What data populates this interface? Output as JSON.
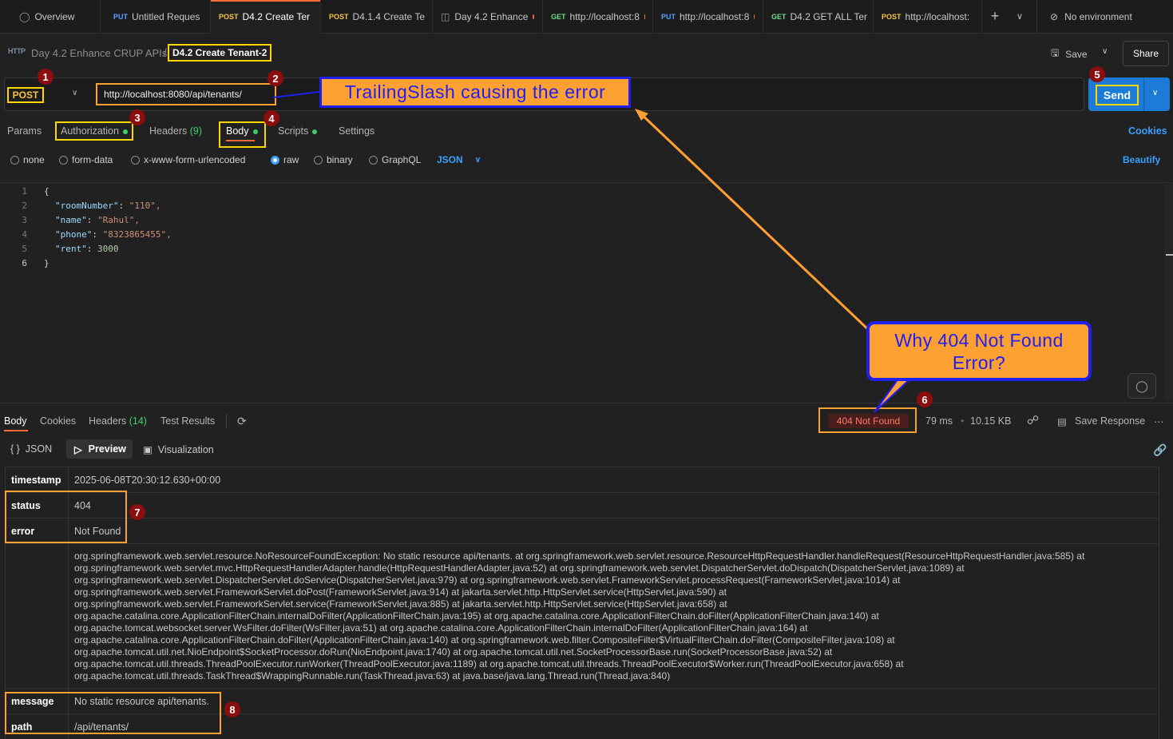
{
  "tabs": [
    {
      "icon": "overview-icon",
      "method": "",
      "label": "Overview",
      "unsaved": false
    },
    {
      "method": "PUT",
      "label": "Untitled Reques",
      "unsaved": true
    },
    {
      "method": "POST",
      "label": "D4.2 Create Ter",
      "unsaved": true,
      "active": true
    },
    {
      "method": "POST",
      "label": "D4.1.4 Create Te",
      "unsaved": false
    },
    {
      "icon": "collection-icon",
      "method": "",
      "label": "Day 4.2 Enhance",
      "unsaved": true
    },
    {
      "method": "GET",
      "label": "http://localhost:8",
      "unsaved": true
    },
    {
      "method": "PUT",
      "label": "http://localhost:8",
      "unsaved": true
    },
    {
      "method": "GET",
      "label": "D4.2 GET ALL Ter",
      "unsaved": false
    },
    {
      "method": "POST",
      "label": "http://localhost:",
      "unsaved": true
    }
  ],
  "environment": "No environment",
  "breadcrumb": {
    "collection": "Day 4.2 Enhance CRUP APIs",
    "separator": "/",
    "request": "D4.2 Create Tenant-2"
  },
  "toolbar": {
    "save": "Save",
    "share": "Share"
  },
  "request": {
    "method": "POST",
    "url": "http://localhost:8080/api/tenants/",
    "send": "Send"
  },
  "request_tabs": {
    "params": "Params",
    "authorization": "Authorization",
    "headers": "Headers",
    "headers_count": "(9)",
    "body": "Body",
    "scripts": "Scripts",
    "settings": "Settings",
    "cookies": "Cookies"
  },
  "body_types": {
    "none": "none",
    "form_data": "form-data",
    "urlencoded": "x-www-form-urlencoded",
    "raw": "raw",
    "binary": "binary",
    "graphql": "GraphQL",
    "format": "JSON",
    "beautify": "Beautify",
    "selected": "raw"
  },
  "editor": {
    "line_numbers": [
      "1",
      "2",
      "3",
      "4",
      "5",
      "6"
    ],
    "lines": [
      {
        "k": "",
        "v": "{"
      },
      {
        "k": "\"roomNumber\"",
        "v": "\"110\","
      },
      {
        "k": "\"name\"",
        "v": "\"Rahul\","
      },
      {
        "k": "\"phone\"",
        "v": "\"8323865455\","
      },
      {
        "k": "\"rent\"",
        "v": "3000"
      },
      {
        "k": "",
        "v": "}"
      }
    ]
  },
  "response_tabs": {
    "body": "Body",
    "cookies": "Cookies",
    "headers": "Headers",
    "headers_count": "(14)",
    "test_results": "Test Results"
  },
  "response_meta": {
    "status": "404 Not Found",
    "time": "79 ms",
    "size": "10.15 KB",
    "save_response": "Save Response"
  },
  "view_modes": {
    "json": "JSON",
    "preview": "Preview",
    "visualization": "Visualization"
  },
  "response": {
    "timestamp_key": "timestamp",
    "timestamp": "2025-06-08T20:30:12.630+00:00",
    "status_key": "status",
    "status": "404",
    "error_key": "error",
    "error": "Not Found",
    "trace": [
      "org.springframework.web.servlet.resource.NoResourceFoundException: No static resource api/tenants. at org.springframework.web.servlet.resource.ResourceHttpRequestHandler.handleRequest(ResourceHttpRequestHandler.java:585) at",
      "org.springframework.web.servlet.mvc.HttpRequestHandlerAdapter.handle(HttpRequestHandlerAdapter.java:52) at org.springframework.web.servlet.DispatcherServlet.doDispatch(DispatcherServlet.java:1089) at",
      "org.springframework.web.servlet.DispatcherServlet.doService(DispatcherServlet.java:979) at org.springframework.web.servlet.FrameworkServlet.processRequest(FrameworkServlet.java:1014) at",
      "org.springframework.web.servlet.FrameworkServlet.doPost(FrameworkServlet.java:914) at jakarta.servlet.http.HttpServlet.service(HttpServlet.java:590) at",
      "org.springframework.web.servlet.FrameworkServlet.service(FrameworkServlet.java:885) at jakarta.servlet.http.HttpServlet.service(HttpServlet.java:658) at",
      "org.apache.catalina.core.ApplicationFilterChain.internalDoFilter(ApplicationFilterChain.java:195) at org.apache.catalina.core.ApplicationFilterChain.doFilter(ApplicationFilterChain.java:140) at",
      "org.apache.tomcat.websocket.server.WsFilter.doFilter(WsFilter.java:51) at org.apache.catalina.core.ApplicationFilterChain.internalDoFilter(ApplicationFilterChain.java:164) at",
      "org.apache.catalina.core.ApplicationFilterChain.doFilter(ApplicationFilterChain.java:140) at org.springframework.web.filter.CompositeFilter$VirtualFilterChain.doFilter(CompositeFilter.java:108) at",
      "org.apache.tomcat.util.net.NioEndpoint$SocketProcessor.doRun(NioEndpoint.java:1740) at org.apache.tomcat.util.net.SocketProcessorBase.run(SocketProcessorBase.java:52) at",
      "org.apache.tomcat.util.threads.ThreadPoolExecutor.runWorker(ThreadPoolExecutor.java:1189) at org.apache.tomcat.util.threads.ThreadPoolExecutor$Worker.run(ThreadPoolExecutor.java:658) at",
      "org.apache.tomcat.util.threads.TaskThread$WrappingRunnable.run(TaskThread.java:63) at java.base/java.lang.Thread.run(Thread.java:840)"
    ],
    "message_key": "message",
    "message": "No static resource api/tenants.",
    "path_key": "path",
    "path": "/api/tenants/"
  },
  "annotations": {
    "badges": [
      "1",
      "2",
      "3",
      "4",
      "5",
      "6",
      "7",
      "8"
    ],
    "callout_url": "TrailingSlash causing the error",
    "callout_question": "Why 404 Not Found Error?"
  },
  "colors": {
    "accent": "#ff6c37",
    "send": "#1c7bd6",
    "highlight_yellow": "#ffd700",
    "highlight_orange": "#ffa033",
    "callout_blue": "#1f1ff0"
  }
}
